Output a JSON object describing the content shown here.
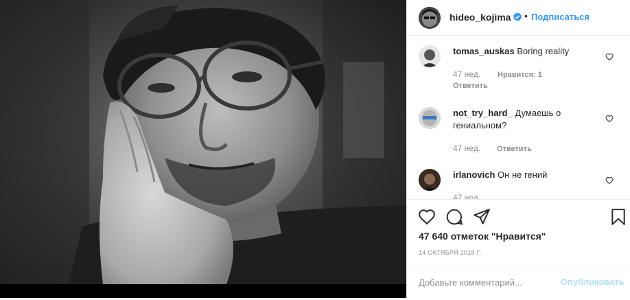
{
  "post": {
    "author": "hideo_kojima",
    "follow_label": "Подписаться",
    "dot": "•"
  },
  "comments": [
    {
      "user": "tomas_auskas",
      "text": "Boring reality",
      "time": "47 нед.",
      "likes": "Нравится: 1",
      "reply": "Ответить"
    },
    {
      "user": "not_try_hard_",
      "text": "Думаешь о гениальном?",
      "time": "47 нед.",
      "reply": "Ответить"
    },
    {
      "user": "irlanovich",
      "text": "Он не гений",
      "time": "47 нед."
    }
  ],
  "stats": {
    "likes_text": "47 640 отметок \"Нравится\"",
    "date": "14 ОКТЯБРЯ 2018 Г."
  },
  "comment_box": {
    "placeholder": "Добавьте комментарий...",
    "publish_label": "Опубликовать"
  },
  "icons": {
    "verified": "verified-badge-icon",
    "like": "heart-icon",
    "comment": "comment-bubble-icon",
    "share": "paper-plane-icon",
    "save": "bookmark-icon"
  },
  "colors": {
    "accent": "#3897f0",
    "publish_disabled": "#b2dffc",
    "muted": "#8e8e8e",
    "text": "#262626"
  }
}
